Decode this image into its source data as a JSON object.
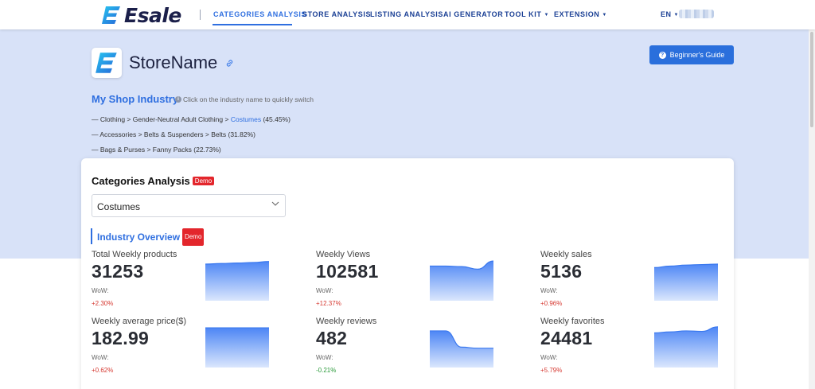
{
  "nav": {
    "brand": "Esale",
    "items": [
      {
        "label": "CATEGORIES ANALYSIS",
        "active": true
      },
      {
        "label": "STORE ANALYSIS"
      },
      {
        "label": "LISTING ANALYSIS"
      },
      {
        "label": "AI GENERATOR"
      },
      {
        "label": "TOOL KIT"
      },
      {
        "label": "EXTENSION"
      }
    ],
    "lang": "EN"
  },
  "store": {
    "name": "StoreName",
    "guide_button": "Beginner's Guide"
  },
  "industry": {
    "title": "My Shop Industry",
    "hint": "Click on the industry name to quickly switch",
    "lines": [
      {
        "path": "— Clothing > Gender-Neutral Adult Clothing > ",
        "highlight": "Costumes",
        "share": " (45.45%)"
      },
      {
        "path": "— Accessories > Belts & Suspenders > Belts (31.82%)",
        "highlight": "",
        "share": ""
      },
      {
        "path": "— Bags & Purses > Fanny Packs (22.73%)",
        "highlight": "",
        "share": ""
      }
    ]
  },
  "card": {
    "title": "Categories Analysis",
    "badge": "Demo",
    "select_value": "Costumes",
    "overview_title": "Industry Overview",
    "overview_badge": "Demo"
  },
  "metrics": [
    {
      "label": "Total Weekly products",
      "value": "31253",
      "wow_label": "WoW:",
      "change": "+2.30%",
      "trend": "up",
      "spark": [
        0.72,
        0.73,
        0.74,
        0.75,
        0.77
      ]
    },
    {
      "label": "Weekly Views",
      "value": "102581",
      "wow_label": "WoW:",
      "change": "+12.37%",
      "trend": "up",
      "spark": [
        0.68,
        0.68,
        0.67,
        0.62,
        0.78
      ]
    },
    {
      "label": "Weekly sales",
      "value": "5136",
      "wow_label": "WoW:",
      "change": "+0.96%",
      "trend": "up",
      "spark": [
        0.65,
        0.68,
        0.7,
        0.71,
        0.72
      ]
    },
    {
      "label": "Weekly average price($)",
      "value": "182.99",
      "wow_label": "WoW:",
      "change": "+0.62%",
      "trend": "up",
      "spark": [
        0.78,
        0.78,
        0.78,
        0.78,
        0.78
      ]
    },
    {
      "label": "Weekly reviews",
      "value": "482",
      "wow_label": "WoW:",
      "change": "-0.21%",
      "trend": "down",
      "spark": [
        0.72,
        0.72,
        0.4,
        0.38,
        0.38
      ]
    },
    {
      "label": "Weekly favorites",
      "value": "24481",
      "wow_label": "WoW:",
      "change": "+5.79%",
      "trend": "up",
      "spark": [
        0.68,
        0.7,
        0.72,
        0.71,
        0.8
      ]
    }
  ],
  "colors": {
    "accent": "#2f6fe0",
    "hero_bg": "#d8e2f8",
    "badge": "#e3262c",
    "positive": "#d63a32",
    "negative": "#2a9a3a"
  }
}
